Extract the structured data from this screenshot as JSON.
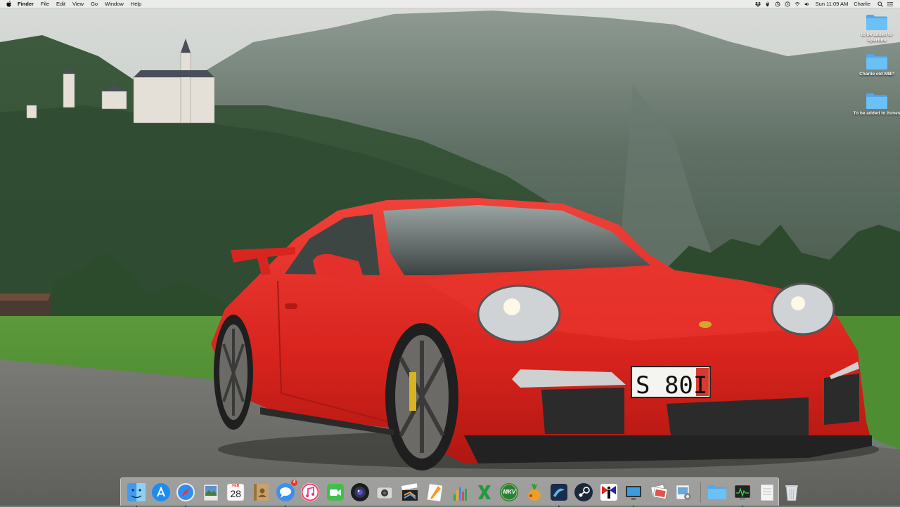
{
  "menubar": {
    "app_name": "Finder",
    "menus": [
      "File",
      "Edit",
      "View",
      "Go",
      "Window",
      "Help"
    ],
    "clock": "Sun 11:09 AM",
    "user": "Charlie"
  },
  "desktop_icons": [
    {
      "label": "to be added to Aperture"
    },
    {
      "label": "Charlie old MBP"
    },
    {
      "label": "To be added to itunes"
    }
  ],
  "dock": {
    "calendar_month": "FEB",
    "calendar_day": "28",
    "messages_badge": "4",
    "mkv_label": "MKV"
  },
  "colors": {
    "folder": "#5ab4f0",
    "car_red": "#e0241f",
    "badge": "#e8372d"
  }
}
